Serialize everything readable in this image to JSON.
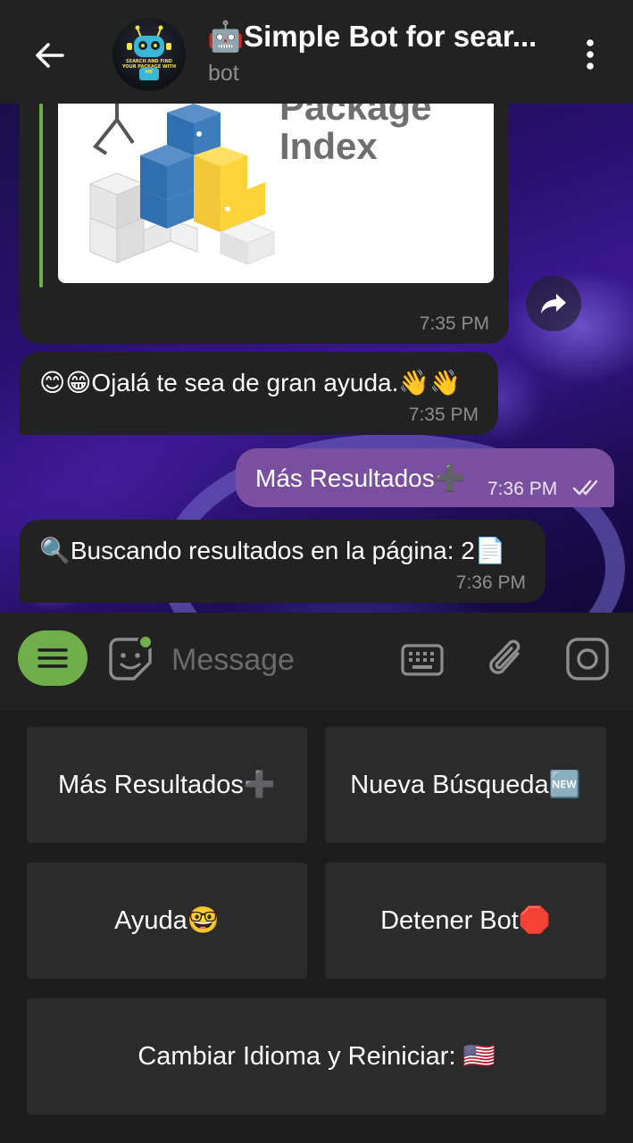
{
  "header": {
    "title": "🤖Simple Bot for sear...",
    "subtitle": "bot",
    "avatar_text": "SEARCH AND FIND YOUR PACKAGE WITH ME"
  },
  "chat": {
    "link_card": {
      "preview_text": "Package\nIndex",
      "time": "7:35 PM"
    },
    "messages": [
      {
        "text": "😊😁Ojalá te sea de gran ayuda.👋👋",
        "time": "7:35 PM"
      },
      {
        "text": "Más Resultados➕",
        "time": "7:36 PM"
      },
      {
        "text": "🔍Buscando resultados en la página: 2📄",
        "time": "7:36 PM"
      }
    ]
  },
  "input": {
    "placeholder": "Message"
  },
  "keyboard": {
    "buttons": [
      "Más Resultados➕",
      "Nueva Búsqueda🆕",
      "Ayuda🤓",
      "Detener Bot🛑",
      "Cambiar Idioma y Reiniciar: 🇺🇸"
    ]
  },
  "colors": {
    "accent_green": "#6fae4a",
    "outgoing_bubble": "#7b4fa0",
    "incoming_bubble": "#212221",
    "header_bg": "#212221",
    "keyboard_button": "#2a2b2a"
  }
}
